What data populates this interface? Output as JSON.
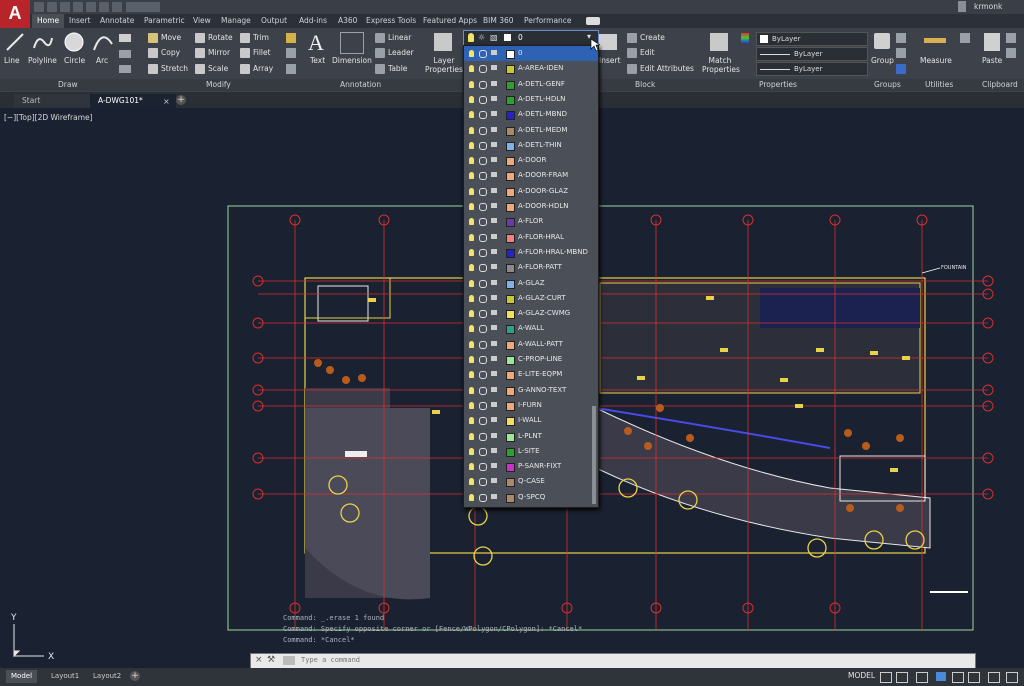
{
  "app": {
    "logo": "A",
    "user": "krmonk"
  },
  "ribbon_tabs": [
    "Home",
    "Insert",
    "Annotate",
    "Parametric",
    "View",
    "Manage",
    "Output",
    "Add-ins",
    "A360",
    "Express Tools",
    "Featured Apps",
    "BIM 360",
    "Performance"
  ],
  "draw": {
    "line": "Line",
    "polyline": "Polyline",
    "circle": "Circle",
    "arc": "Arc",
    "panel": "Draw"
  },
  "modify": {
    "move": "Move",
    "rotate": "Rotate",
    "trim": "Trim",
    "copy": "Copy",
    "mirror": "Mirror",
    "fillet": "Fillet",
    "stretch": "Stretch",
    "scale": "Scale",
    "array": "Array",
    "panel": "Modify"
  },
  "annotation": {
    "text": "Text",
    "dimension": "Dimension",
    "linear": "Linear",
    "leader": "Leader",
    "table": "Table",
    "panel": "Annotation"
  },
  "layers": {
    "properties": "Layer Properties",
    "current": "0"
  },
  "block": {
    "insert": "Insert",
    "create": "Create",
    "edit": "Edit",
    "edit_attributes": "Edit Attributes",
    "panel": "Block"
  },
  "properties": {
    "match": "Match Properties",
    "color": "ByLayer",
    "linetype": "ByLayer",
    "lineweight": "ByLayer",
    "panel": "Properties"
  },
  "groups": {
    "group": "Group",
    "panel": "Groups"
  },
  "utilities": {
    "measure": "Measure",
    "panel": "Utilities"
  },
  "clipboard": {
    "paste": "Paste",
    "panel": "Clipboard"
  },
  "doc_tabs": [
    "Start",
    "A-DWG101*"
  ],
  "viewport_label": "[−][Top][2D Wireframe]",
  "layer_list": [
    {
      "name": "0",
      "color": "#ffffff"
    },
    {
      "name": "A-AREA-IDEN",
      "color": "#c8c832"
    },
    {
      "name": "A-DETL-GENF",
      "color": "#2fa02f"
    },
    {
      "name": "A-DETL-HDLN",
      "color": "#2fa02f"
    },
    {
      "name": "A-DETL-MBND",
      "color": "#2323c8"
    },
    {
      "name": "A-DETL-MEDM",
      "color": "#a88a6a"
    },
    {
      "name": "A-DETL-THIN",
      "color": "#7fb2e8"
    },
    {
      "name": "A-DOOR",
      "color": "#f0a878"
    },
    {
      "name": "A-DOOR-FRAM",
      "color": "#f0a878"
    },
    {
      "name": "A-DOOR-GLAZ",
      "color": "#f0a878"
    },
    {
      "name": "A-DOOR-HDLN",
      "color": "#f0a878"
    },
    {
      "name": "A-FLOR",
      "color": "#6a3aa8"
    },
    {
      "name": "A-FLOR-HRAL",
      "color": "#f08080"
    },
    {
      "name": "A-FLOR-HRAL-MBND",
      "color": "#2323c8"
    },
    {
      "name": "A-FLOR-PATT",
      "color": "#8a8a8a"
    },
    {
      "name": "A-GLAZ",
      "color": "#7fb2e8"
    },
    {
      "name": "A-GLAZ-CURT",
      "color": "#c8c832"
    },
    {
      "name": "A-GLAZ-CWMG",
      "color": "#f0e060"
    },
    {
      "name": "A-WALL",
      "color": "#2fa08a"
    },
    {
      "name": "A-WALL-PATT",
      "color": "#f0a878"
    },
    {
      "name": "C-PROP-LINE",
      "color": "#9ae89a"
    },
    {
      "name": "E-LITE-EQPM",
      "color": "#f0a878"
    },
    {
      "name": "G-ANNO-TEXT",
      "color": "#f0a878"
    },
    {
      "name": "I-FURN",
      "color": "#f0a878"
    },
    {
      "name": "I-WALL",
      "color": "#f0e060"
    },
    {
      "name": "L-PLNT",
      "color": "#9ae89a"
    },
    {
      "name": "L-SITE",
      "color": "#2fa02f"
    },
    {
      "name": "P-SANR-FIXT",
      "color": "#c832c8"
    },
    {
      "name": "Q-CASE",
      "color": "#a88a6a"
    },
    {
      "name": "Q-SPCQ",
      "color": "#a88a6a"
    }
  ],
  "command_history": [
    "Command: _.erase 1 found",
    "Command: Specify opposite corner or [Fence/WPolygon/CPolygon]: *Cancel*",
    "Command: *Cancel*"
  ],
  "command_placeholder": "Type a command",
  "status": {
    "model": "MODEL",
    "tabs": [
      "Model",
      "Layout1",
      "Layout2"
    ]
  },
  "annotation_label": "FOUNTAIN"
}
